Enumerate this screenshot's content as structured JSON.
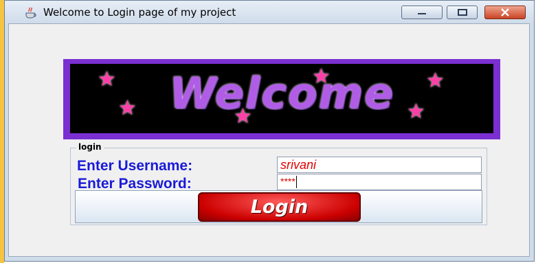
{
  "window": {
    "title": "Welcome to Login page of my project",
    "icon": "java-coffee-icon",
    "controls": [
      "minimize",
      "maximize",
      "close"
    ]
  },
  "banner": {
    "text": "Welcome",
    "background": "#000000",
    "text_color": "#b15ce6",
    "border_color": "#7a2fd1",
    "star_color": "#ff3fa8"
  },
  "form": {
    "legend": "login",
    "username_label": "Enter Username:",
    "username_value": "srivani",
    "password_label": "Enter Password:",
    "password_value": "****",
    "login_button": "Login"
  },
  "colors": {
    "label": "#1a1ad8",
    "field_text": "#e00000",
    "button": "#cc0000"
  }
}
